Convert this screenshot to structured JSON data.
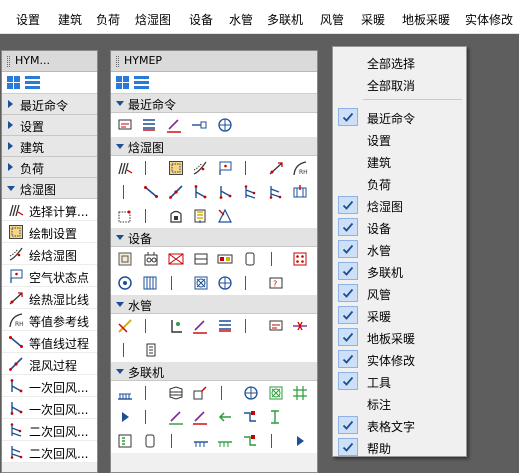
{
  "menubar": {
    "items": [
      "设置",
      "建筑",
      "负荷",
      "焓湿图",
      "设备",
      "水管",
      "多联机",
      "风管",
      "采暖",
      "地板采暖",
      "实体修改"
    ]
  },
  "left_panel": {
    "title": "HYM...",
    "categories": [
      {
        "label": "最近命令",
        "expanded": false
      },
      {
        "label": "设置",
        "expanded": false
      },
      {
        "label": "建筑",
        "expanded": false
      },
      {
        "label": "负荷",
        "expanded": false
      },
      {
        "label": "焓湿图",
        "expanded": true
      }
    ],
    "commands": [
      {
        "label": "选择计算...",
        "icon": "calc-select-icon"
      },
      {
        "label": "绘制设置",
        "icon": "draw-settings-icon"
      },
      {
        "label": "绘焓湿图",
        "icon": "draw-psychrometric-icon"
      },
      {
        "label": "空气状态点",
        "icon": "air-state-point-icon"
      },
      {
        "label": "绘热湿比线",
        "icon": "heat-humidity-ratio-line-icon"
      },
      {
        "label": "等值参考线",
        "icon": "rh-reference-line-icon"
      },
      {
        "label": "等值线过程",
        "icon": "isoline-process-icon"
      },
      {
        "label": "混风过程",
        "icon": "mixing-process-icon"
      },
      {
        "label": "一次回风...",
        "icon": "primary-return-air-icon"
      },
      {
        "label": "一次回风...",
        "icon": "primary-return-air-icon"
      },
      {
        "label": "二次回风...",
        "icon": "secondary-return-air-icon"
      },
      {
        "label": "二次回风...",
        "icon": "secondary-return-air-icon"
      }
    ]
  },
  "right_panel": {
    "title": "HYMEP",
    "sections": [
      {
        "label": "最近命令"
      },
      {
        "label": "焓湿图"
      },
      {
        "label": "设备"
      },
      {
        "label": "水管"
      },
      {
        "label": "多联机"
      }
    ]
  },
  "context_menu": {
    "top": [
      "全部选择",
      "全部取消"
    ],
    "items": [
      {
        "label": "最近命令",
        "checked": true
      },
      {
        "label": "设置",
        "checked": false
      },
      {
        "label": "建筑",
        "checked": false
      },
      {
        "label": "负荷",
        "checked": false
      },
      {
        "label": "焓湿图",
        "checked": true
      },
      {
        "label": "设备",
        "checked": true
      },
      {
        "label": "水管",
        "checked": true
      },
      {
        "label": "多联机",
        "checked": true
      },
      {
        "label": "风管",
        "checked": true
      },
      {
        "label": "采暖",
        "checked": true
      },
      {
        "label": "地板采暖",
        "checked": true
      },
      {
        "label": "实体修改",
        "checked": true
      },
      {
        "label": "工具",
        "checked": true
      },
      {
        "label": "标注",
        "checked": false
      },
      {
        "label": "表格文字",
        "checked": true
      },
      {
        "label": "帮助",
        "checked": true
      }
    ]
  },
  "colors": {
    "accent": "#2a7bd8",
    "check_bg": "#cde0f8",
    "workspace": "#5e5e5e"
  }
}
